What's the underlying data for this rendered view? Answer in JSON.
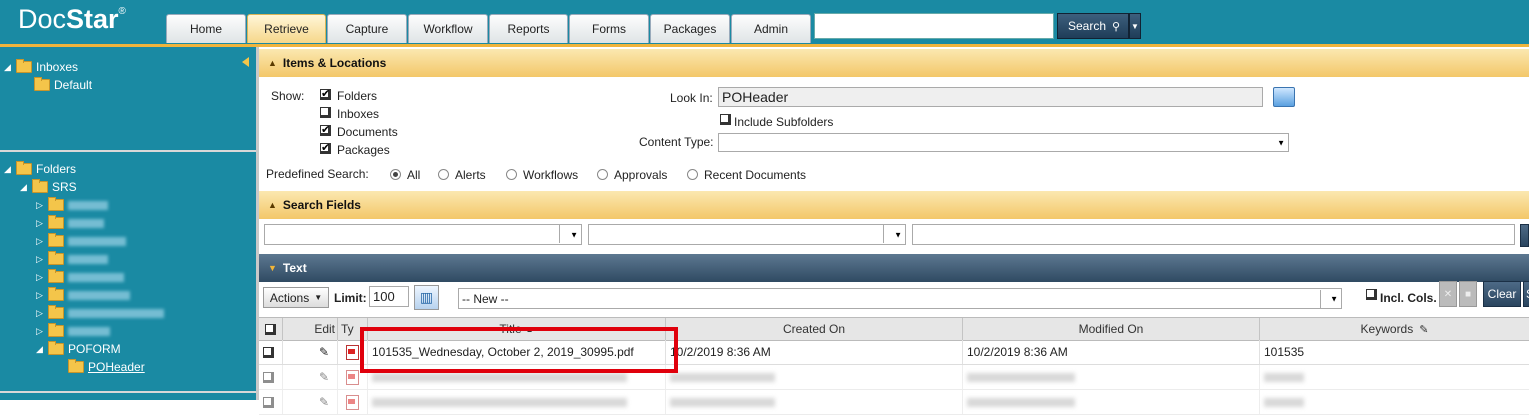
{
  "app": {
    "logo_doc": "Doc",
    "logo_star": "Star",
    "logo_reg": "®"
  },
  "nav": {
    "tabs": [
      "Home",
      "Retrieve",
      "Capture",
      "Workflow",
      "Reports",
      "Forms",
      "Packages",
      "Admin"
    ],
    "active_tab": "Retrieve",
    "search_value": "",
    "search_label": "Search"
  },
  "sidebar": {
    "inboxes_label": "Inboxes",
    "inbox_default": "Default",
    "folders_label": "Folders",
    "root_folder": "SRS",
    "poform": "POFORM",
    "poheader": "POHeader"
  },
  "items_locations": {
    "title": "Items & Locations",
    "show_label": "Show:",
    "show_options": [
      {
        "label": "Folders",
        "checked": true
      },
      {
        "label": "Inboxes",
        "checked": false
      },
      {
        "label": "Documents",
        "checked": true
      },
      {
        "label": "Packages",
        "checked": true
      }
    ],
    "look_in_label": "Look In:",
    "look_in_value": "POHeader",
    "include_subfolders_label": "Include Subfolders",
    "include_subfolders_checked": false,
    "content_type_label": "Content Type:",
    "content_type_value": "",
    "predefined_label": "Predefined Search:",
    "predefined_options": [
      "All",
      "Alerts",
      "Workflows",
      "Approvals",
      "Recent Documents"
    ],
    "predefined_selected": "All"
  },
  "search_fields": {
    "title": "Search Fields"
  },
  "text_section": {
    "title": "Text",
    "actions_label": "Actions",
    "limit_label": "Limit:",
    "limit_value": "100",
    "saved_search_value": "-- New --",
    "incl_cols_label": "Incl. Cols.",
    "clear_label": "Clear",
    "search_short": "S"
  },
  "grid": {
    "columns": [
      "Edit",
      "Ty",
      "Title",
      "Created On",
      "Modified On",
      "Keywords"
    ],
    "rows": [
      {
        "title": "101535_Wednesday, October 2, 2019_30995.pdf",
        "created_on": "10/2/2019 8:36 AM",
        "modified_on": "10/2/2019 8:36 AM",
        "keywords": "101535"
      }
    ]
  },
  "colors": {
    "header_teal": "#1a8aa3",
    "accent_gold": "#f0b43c",
    "highlight_red": "#e0000c"
  }
}
